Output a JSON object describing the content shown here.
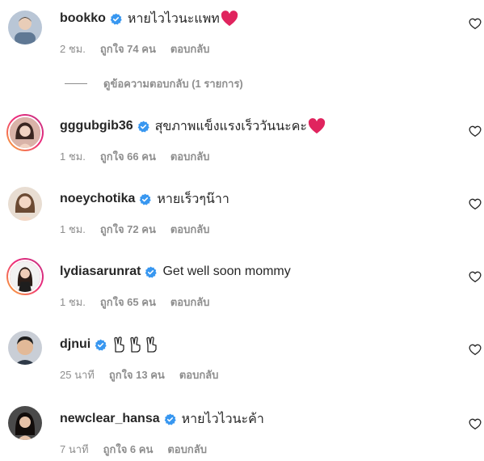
{
  "colors": {
    "verified": "#3897f0",
    "meta_text": "#8e8e8e",
    "heart_emoji": "#e0245e"
  },
  "view_replies": "ดูข้อความตอบกลับ (1 รายการ)",
  "comments": [
    {
      "username": "bookko",
      "text": "หายไวไวนะแพท",
      "emoji": "red-heart",
      "time": "2 ชม.",
      "likes": "ถูกใจ 74 คน",
      "reply": "ตอบกลับ"
    },
    {
      "username": "gggubgib36",
      "text": "สุขภาพแข็งแรงเร็ววันนะคะ",
      "emoji": "red-heart",
      "time": "1 ชม.",
      "likes": "ถูกใจ 66 คน",
      "reply": "ตอบกลับ"
    },
    {
      "username": "noeychotika",
      "text": "หายเร็วๆน๊าา",
      "emoji": "",
      "time": "1 ชม.",
      "likes": "ถูกใจ 72 คน",
      "reply": "ตอบกลับ"
    },
    {
      "username": "lydiasarunrat",
      "text": "Get well soon mommy",
      "emoji": "",
      "time": "1 ชม.",
      "likes": "ถูกใจ 65 คน",
      "reply": "ตอบกลับ"
    },
    {
      "username": "djnui",
      "text": "",
      "emoji": "victory-hands",
      "time": "25 นาที",
      "likes": "ถูกใจ 13 คน",
      "reply": "ตอบกลับ"
    },
    {
      "username": "newclear_hansa",
      "text": "หายไวไวนะค้า",
      "emoji": "",
      "time": "7 นาที",
      "likes": "ถูกใจ 6 คน",
      "reply": "ตอบกลับ"
    }
  ]
}
